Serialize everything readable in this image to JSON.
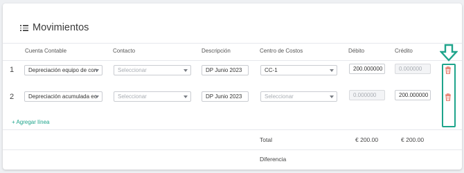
{
  "section": {
    "title": "Movimientos",
    "icon": "list-icon"
  },
  "columns": {
    "cuenta": "Cuenta Contable",
    "contacto": "Contacto",
    "descripcion": "Descripción",
    "centro": "Centro de Costos",
    "debito": "Débito",
    "credito": "Crédito"
  },
  "rows": [
    {
      "num": "1",
      "cuenta": "Depreciación equipo de con",
      "contacto_placeholder": "Seleccionar",
      "descripcion": "DP Junio 2023",
      "centro": "CC-1",
      "debito": "200.000000",
      "credito": "0.000000",
      "delete_icon": "trash-icon"
    },
    {
      "num": "2",
      "cuenta": "Depreciación acumulada ec",
      "contacto_placeholder": "Seleccionar",
      "descripcion": "DP Junio 2023",
      "centro_placeholder": "Seleccionar",
      "debito": "0.000000",
      "credito": "200.000000",
      "delete_icon": "trash-icon"
    }
  ],
  "actions": {
    "add_line": "Agregar línea"
  },
  "totals": {
    "total_label": "Total",
    "debito": "€ 200.00",
    "credito": "€ 200.00",
    "diferencia_label": "Diferencia"
  },
  "colors": {
    "accent": "#1ea48b",
    "danger": "#e36d5d",
    "annotation": "#1ea48b"
  }
}
